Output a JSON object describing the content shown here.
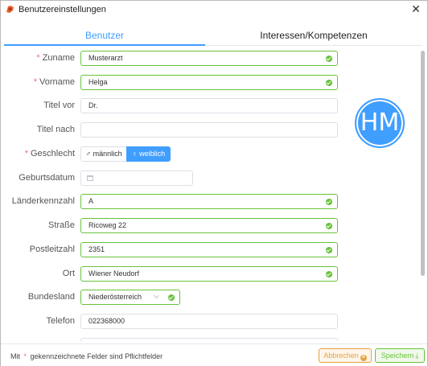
{
  "window": {
    "title": "Benutzereinstellungen"
  },
  "tabs": [
    {
      "label": "Benutzer",
      "active": true
    },
    {
      "label": "Interessen/Kompetenzen",
      "active": false
    }
  ],
  "avatar": {
    "initials": "HM",
    "color": "#409eff"
  },
  "form": {
    "zuname": {
      "label": "Zuname",
      "required": true,
      "value": "Musterarzt",
      "valid": true
    },
    "vorname": {
      "label": "Vorname",
      "required": true,
      "value": "Helga",
      "valid": true
    },
    "titel_vor": {
      "label": "Titel vor",
      "required": false,
      "value": "Dr."
    },
    "titel_nach": {
      "label": "Titel nach",
      "required": false,
      "value": ""
    },
    "geschlecht": {
      "label": "Geschlecht",
      "required": true,
      "options": [
        "♂ männlich",
        "♀ weiblich"
      ],
      "selected": "♀ weiblich"
    },
    "geburtsdatum": {
      "label": "Geburtsdatum",
      "required": false,
      "value": ""
    },
    "laenderkennzahl": {
      "label": "Länderkennzahl",
      "required": false,
      "value": "A",
      "valid": true
    },
    "strasse": {
      "label": "Straße",
      "required": false,
      "value": "Ricoweg 22",
      "valid": true
    },
    "postleitzahl": {
      "label": "Postleitzahl",
      "required": false,
      "value": "2351",
      "valid": true
    },
    "ort": {
      "label": "Ort",
      "required": false,
      "value": "Wiener Neudorf",
      "valid": true
    },
    "bundesland": {
      "label": "Bundesland",
      "required": false,
      "value": "Niederösterreich",
      "valid": true
    },
    "telefon": {
      "label": "Telefon",
      "required": false,
      "value": "022368000"
    }
  },
  "footer": {
    "note_prefix": "Mit",
    "note_star": "*",
    "note_suffix": "gekennzeichnete Felder sind Pflichtfelder",
    "cancel_label": "Abbrechen",
    "save_label": "Speichern"
  },
  "colors": {
    "accent": "#409eff",
    "valid": "#67c23a",
    "required": "#f56c6c",
    "cancel": "#e6a23c"
  }
}
